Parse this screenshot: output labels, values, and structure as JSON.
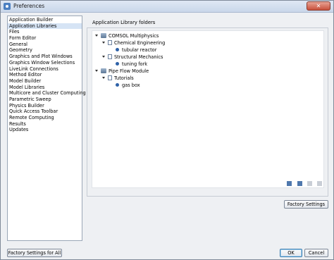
{
  "window": {
    "title": "Preferences",
    "close_glyph": "✕"
  },
  "sidebar": {
    "items": [
      "Application Builder",
      "Application Libraries",
      "Files",
      "Form Editor",
      "General",
      "Geometry",
      "Graphics and Plot Windows",
      "Graphics Window Selections",
      "LiveLink Connections",
      "Method Editor",
      "Model Builder",
      "Model Libraries",
      "Multicore and Cluster Computing",
      "Parametric Sweep",
      "Physics Builder",
      "Quick Access Toolbar",
      "Remote Computing",
      "Results",
      "Updates"
    ],
    "selected_index": 1
  },
  "panel": {
    "title": "Application Library folders"
  },
  "tree": [
    {
      "label": "COMSOL Multiphysics",
      "icon": "database-icon",
      "level": 0
    },
    {
      "label": "Chemical Engineering",
      "icon": "folder-doc-icon",
      "level": 1
    },
    {
      "label": "tubular reactor",
      "icon": "item-dot-icon",
      "level": 2
    },
    {
      "label": "Structural Mechanics",
      "icon": "folder-doc-icon",
      "level": 1
    },
    {
      "label": "tuning fork",
      "icon": "item-dot-icon",
      "level": 2
    },
    {
      "label": "Pipe Flow Module",
      "icon": "module-icon",
      "level": 0
    },
    {
      "label": "Tutorials",
      "icon": "folder-doc-icon",
      "level": 1
    },
    {
      "label": "gas box",
      "icon": "item-dot-icon",
      "level": 2
    }
  ],
  "buttons": {
    "factory_settings": "Factory Settings",
    "factory_settings_all": "Factory Settings for All",
    "ok": "OK",
    "cancel": "Cancel"
  }
}
